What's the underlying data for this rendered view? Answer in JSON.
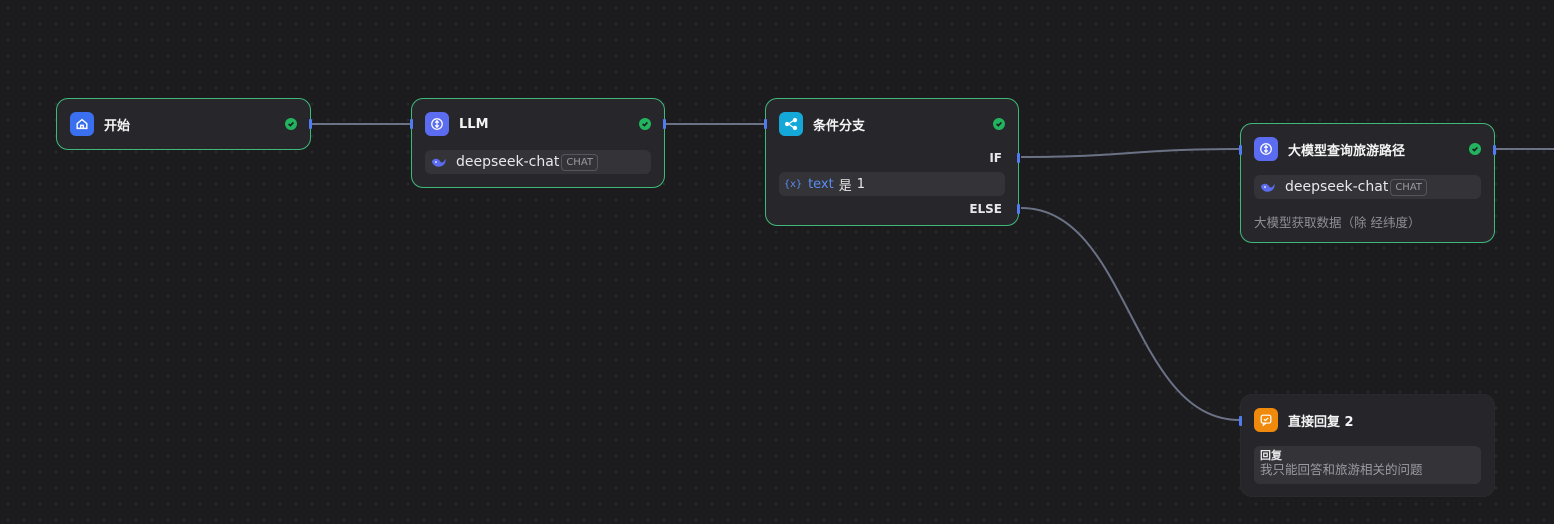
{
  "canvas": {
    "edge_color": "#6b7285",
    "handle_color": "#4f7cf0",
    "success_color": "#22b35e",
    "node_border_color": "#3fb97a"
  },
  "nodes": {
    "start": {
      "title": "开始",
      "icon": "home-icon",
      "icon_color": "#3a6ff0"
    },
    "llm": {
      "title": "LLM",
      "icon": "llm-icon",
      "icon_color": "#5b6cf0",
      "model": "deepseek-chat",
      "model_badge": "CHAT",
      "model_icon": "whale-icon"
    },
    "condition": {
      "title": "条件分支",
      "icon": "branch-icon",
      "icon_color": "#14a8d8",
      "if_label": "IF",
      "else_label": "ELSE",
      "var_icon_text": "{x}",
      "variable": "text",
      "operator": "是",
      "value": "1"
    },
    "route_llm": {
      "title": "大模型查询旅游路径",
      "icon": "llm-icon",
      "icon_color": "#5b6cf0",
      "model": "deepseek-chat",
      "model_badge": "CHAT",
      "model_icon": "whale-icon",
      "description": "大模型获取数据（除 经纬度）"
    },
    "answer": {
      "title": "直接回复 2",
      "icon": "reply-icon",
      "icon_color": "#f08a0c",
      "reply_label": "回复",
      "reply_text": "我只能回答和旅游相关的问题"
    }
  }
}
